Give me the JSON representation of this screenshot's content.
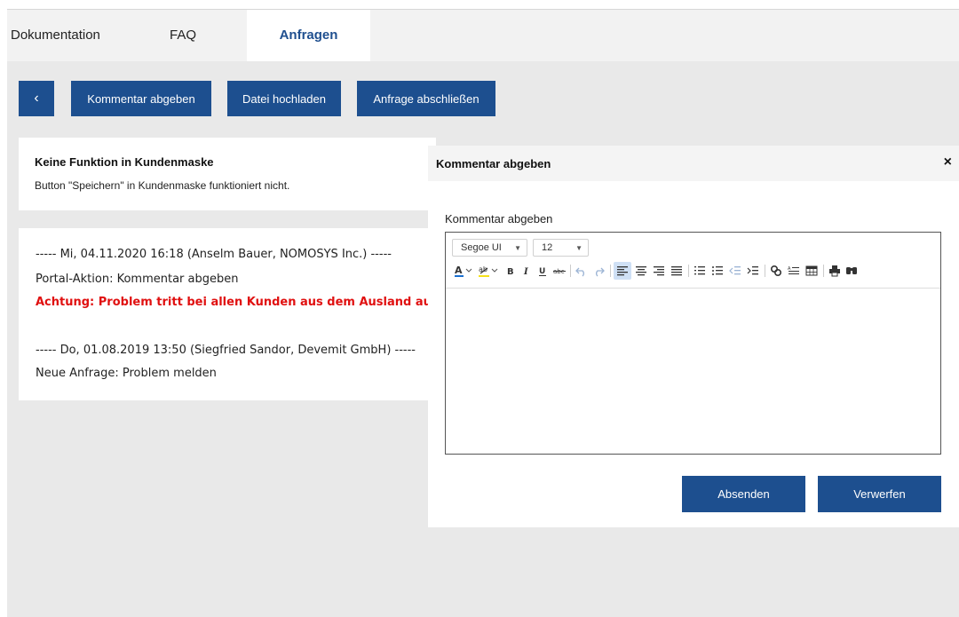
{
  "tabs": {
    "documentation": "Dokumentation",
    "faq": "FAQ",
    "requests": "Anfragen"
  },
  "toolbar": {
    "back_icon": "chevron-left-icon",
    "back_glyph": "‹",
    "comment_label": "Kommentar abgeben",
    "upload_label": "Datei hochladen",
    "close_label": "Anfrage abschließen"
  },
  "request": {
    "title": "Keine Funktion in Kundenmaske",
    "description": "Button \"Speichern\" in Kundenmaske funktioniert nicht."
  },
  "log": {
    "entry1_header": "----- Mi, 04.11.2020 16:18 (Anselm Bauer, NOMOSYS Inc.) -----",
    "entry1_action": "Portal-Aktion: Kommentar abgeben",
    "entry1_alert": "Achtung: Problem tritt bei allen Kunden aus dem Ausland auf!",
    "entry2_header": "----- Do, 01.08.2019 13:50 (Siegfried Sandor, Devemit GmbH) -----",
    "entry2_action": "Neue Anfrage: Problem melden"
  },
  "dialog": {
    "title": "Kommentar abgeben",
    "close_glyph": "×",
    "field_label": "Kommentar abgeben",
    "font_family_value": "Segoe UI",
    "font_size_value": "12",
    "send_label": "Absenden",
    "discard_label": "Verwerfen"
  },
  "colors": {
    "primary": "#1d4f8f",
    "alert": "#e01010",
    "background": "#e9e9e9"
  }
}
